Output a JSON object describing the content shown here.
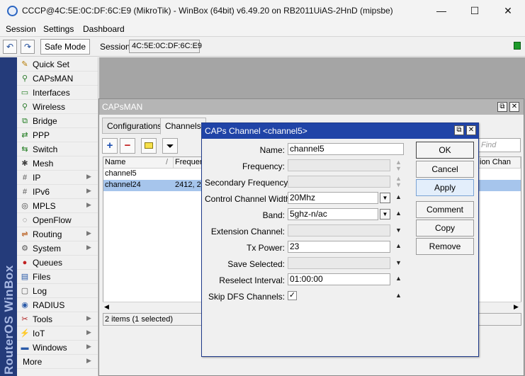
{
  "window": {
    "title": "CCCP@4C:5E:0C:DF:6C:E9 (MikroTik) - WinBox (64bit) v6.49.20 on RB2011UiAS-2HnD (mipsbe)",
    "minimize": "—",
    "maximize": "☐",
    "close": "✕"
  },
  "menu": {
    "session": "Session",
    "settings": "Settings",
    "dashboard": "Dashboard"
  },
  "toolbar": {
    "undo": "↶",
    "redo": "↷",
    "safe_mode": "Safe Mode",
    "session_label": "Session:",
    "session_value": "4C:5E:0C:DF:6C:E9"
  },
  "brand": "RouterOS WinBox",
  "sidebar": {
    "items": [
      {
        "label": "Quick Set",
        "icon": "✎",
        "arrow": ""
      },
      {
        "label": "CAPsMAN",
        "icon": "⚲",
        "arrow": ""
      },
      {
        "label": "Interfaces",
        "icon": "▭",
        "arrow": ""
      },
      {
        "label": "Wireless",
        "icon": "⚲",
        "arrow": ""
      },
      {
        "label": "Bridge",
        "icon": "⧉",
        "arrow": ""
      },
      {
        "label": "PPP",
        "icon": "⇄",
        "arrow": ""
      },
      {
        "label": "Switch",
        "icon": "⇆",
        "arrow": ""
      },
      {
        "label": "Mesh",
        "icon": "✱",
        "arrow": ""
      },
      {
        "label": "IP",
        "icon": "#",
        "arrow": "▶"
      },
      {
        "label": "IPv6",
        "icon": "#",
        "arrow": "▶"
      },
      {
        "label": "MPLS",
        "icon": "◎",
        "arrow": "▶"
      },
      {
        "label": "OpenFlow",
        "icon": "◌",
        "arrow": ""
      },
      {
        "label": "Routing",
        "icon": "⇌",
        "arrow": "▶"
      },
      {
        "label": "System",
        "icon": "⚙",
        "arrow": "▶"
      },
      {
        "label": "Queues",
        "icon": "●",
        "arrow": ""
      },
      {
        "label": "Files",
        "icon": "▤",
        "arrow": ""
      },
      {
        "label": "Log",
        "icon": "▢",
        "arrow": ""
      },
      {
        "label": "RADIUS",
        "icon": "◉",
        "arrow": ""
      },
      {
        "label": "Tools",
        "icon": "✂",
        "arrow": "▶"
      },
      {
        "label": "IoT",
        "icon": "⚡",
        "arrow": "▶"
      },
      {
        "label": "Windows",
        "icon": "▬",
        "arrow": "▶"
      },
      {
        "label": "More",
        "icon": "",
        "arrow": "▶"
      }
    ]
  },
  "capsman": {
    "title": "CAPsMAN",
    "restore": "⧉",
    "close": "✕",
    "tabs": [
      "Configurations",
      "Channels"
    ],
    "find_placeholder": "Find",
    "columns": [
      "Name",
      "Frequen",
      "ion Chan"
    ],
    "sort_marker": "/",
    "rows": [
      {
        "name": "channel5",
        "freq": ""
      },
      {
        "name": "channel24",
        "freq": "2412, 2"
      }
    ],
    "scroll_left": "◀",
    "scroll_right": "▶",
    "status": "2 items (1 selected)"
  },
  "dialog": {
    "title": "CAPs Channel <channel5>",
    "restore": "⧉",
    "close": "✕",
    "fields": {
      "name": {
        "label": "Name:",
        "value": "channel5"
      },
      "frequency": {
        "label": "Frequency:",
        "value": ""
      },
      "secondary_frequency": {
        "label": "Secondary Frequency:",
        "value": ""
      },
      "control_channel_width": {
        "label": "Control Channel Width:",
        "value": "20Mhz"
      },
      "band": {
        "label": "Band:",
        "value": "5ghz-n/ac"
      },
      "extension_channel": {
        "label": "Extension Channel:",
        "value": ""
      },
      "tx_power": {
        "label": "Tx Power:",
        "value": "23"
      },
      "save_selected": {
        "label": "Save Selected:",
        "value": ""
      },
      "reselect_interval": {
        "label": "Reselect Interval:",
        "value": "01:00:00"
      },
      "skip_dfs_channels": {
        "label": "Skip DFS Channels:",
        "value": "✓"
      }
    },
    "buttons": {
      "ok": "OK",
      "cancel": "Cancel",
      "apply": "Apply",
      "comment": "Comment",
      "copy": "Copy",
      "remove": "Remove"
    }
  }
}
